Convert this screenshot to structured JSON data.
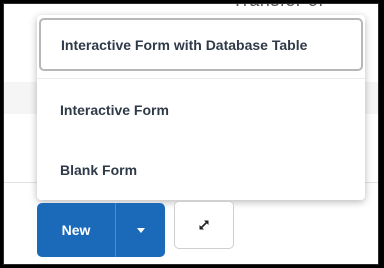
{
  "background": {
    "partial_text_top": "Transfer of",
    "partial_text_right": "on"
  },
  "dropdown": {
    "items": [
      {
        "label": "Interactive Form with Database Table"
      },
      {
        "label": "Interactive Form"
      },
      {
        "label": "Blank Form"
      }
    ]
  },
  "toolbar": {
    "new_label": "New",
    "new_menu_icon": "caret-down-icon",
    "expand_icon": "expand-diagonal-arrows-icon"
  },
  "colors": {
    "primary_button": "#1b6ab9",
    "menu_text": "#2f3a48"
  }
}
